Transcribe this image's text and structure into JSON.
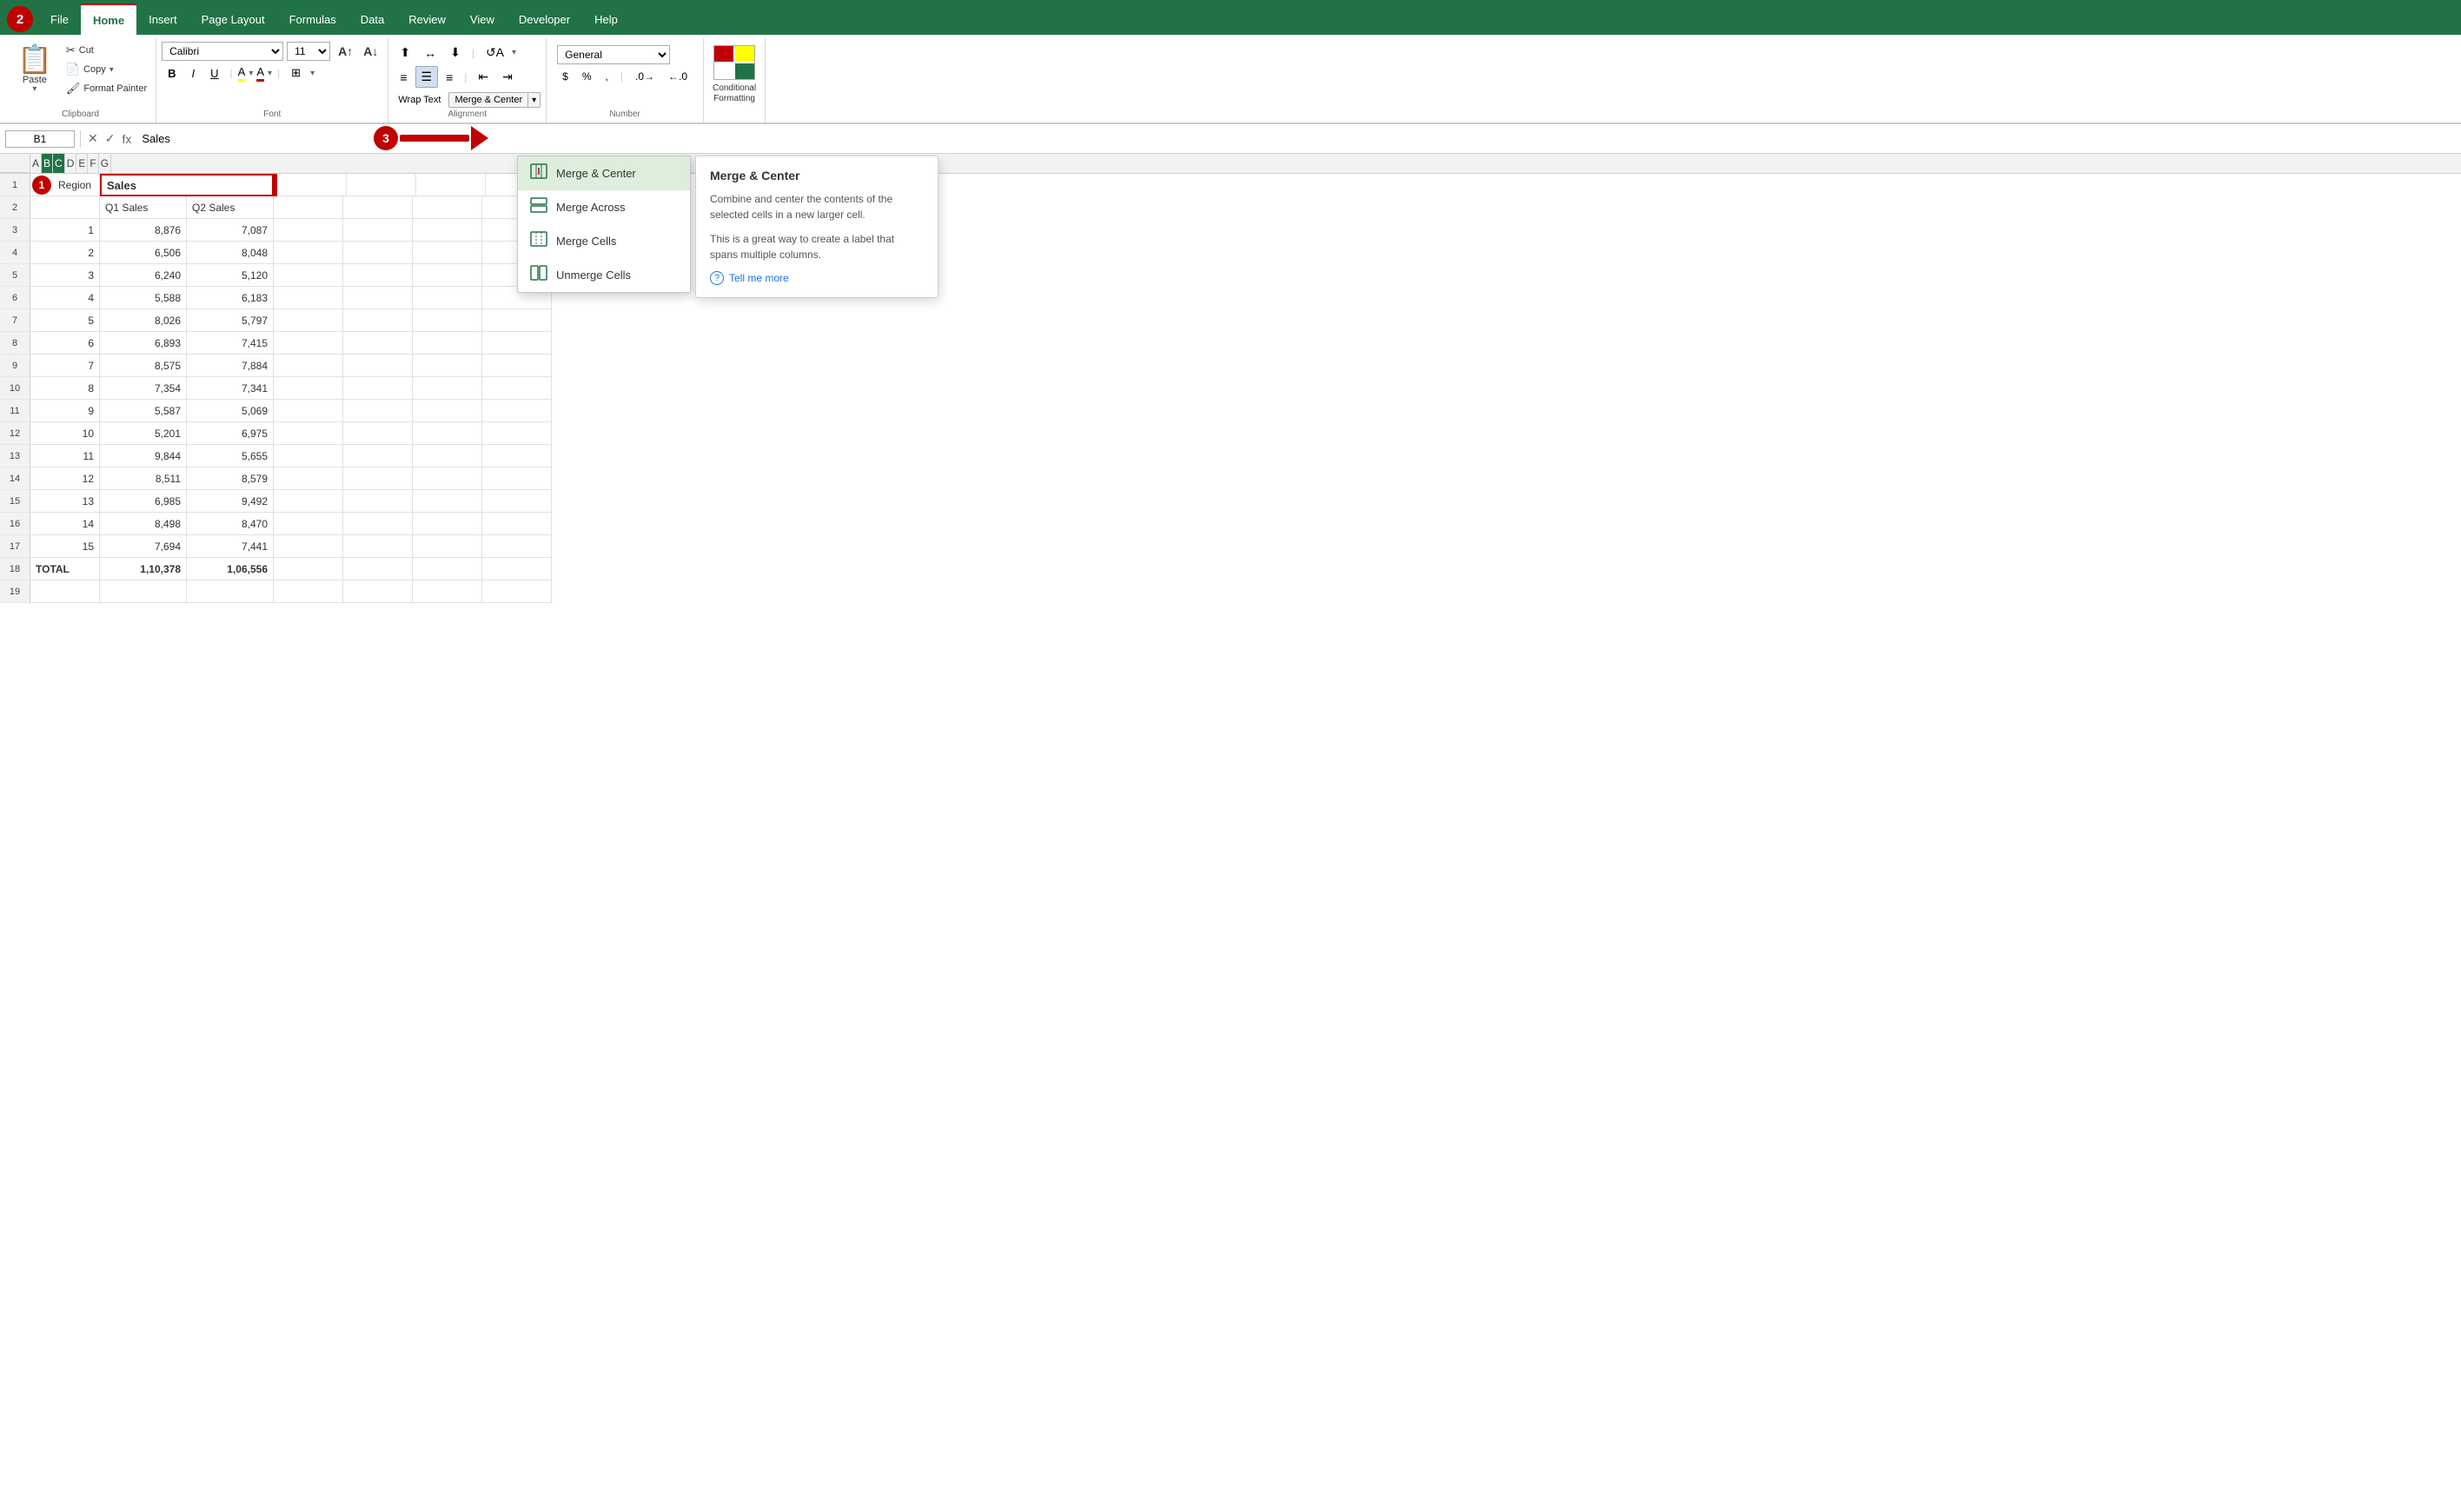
{
  "tabs": {
    "active": "Home",
    "items": [
      "File",
      "Home",
      "Insert",
      "Page Layout",
      "Formulas",
      "Data",
      "Review",
      "View",
      "Developer",
      "Help"
    ]
  },
  "clipboard": {
    "paste": "Paste",
    "cut": "Cut",
    "copy": "Copy",
    "format_painter": "Format Painter",
    "group_label": "Clipboard"
  },
  "font": {
    "family": "Calibri",
    "size": "11",
    "bold": "B",
    "italic": "I",
    "underline": "U",
    "group_label": "Font"
  },
  "alignment": {
    "wrap_text": "Wrap Text",
    "merge_center": "Merge & Center",
    "group_label": "Alignment"
  },
  "number": {
    "format": "General",
    "group_label": "Number"
  },
  "formula_bar": {
    "cell_ref": "B1",
    "value": "Sales"
  },
  "steps": {
    "step1": "1",
    "step2": "2",
    "step3": "3"
  },
  "merge_menu": {
    "title": "Merge & Center",
    "items": [
      {
        "id": "merge-center",
        "label": "Merge & Center",
        "icon": "⊞"
      },
      {
        "id": "merge-across",
        "label": "Merge Across",
        "icon": "⊟"
      },
      {
        "id": "merge-cells",
        "label": "Merge Cells",
        "icon": "⊠"
      },
      {
        "id": "unmerge-cells",
        "label": "Unmerge Cells",
        "icon": "⊡"
      }
    ]
  },
  "tooltip": {
    "title": "Merge & Center",
    "desc1": "Combine and center the contents of the selected cells in a new larger cell.",
    "desc2": "This is a great way to create a label that spans multiple columns.",
    "link": "Tell me more"
  },
  "columns": [
    "A",
    "B",
    "C",
    "D",
    "E",
    "F",
    "G"
  ],
  "rows": [
    {
      "num": "1",
      "a": "Region",
      "b": "Sales",
      "c": "",
      "d": "",
      "e": "",
      "f": "",
      "g": ""
    },
    {
      "num": "2",
      "a": "",
      "b": "Q1 Sales",
      "c": "Q2 Sales",
      "d": "",
      "e": "",
      "f": "",
      "g": ""
    },
    {
      "num": "3",
      "a": "1",
      "b": "8,876",
      "c": "7,087",
      "d": "",
      "e": "",
      "f": "",
      "g": ""
    },
    {
      "num": "4",
      "a": "2",
      "b": "6,506",
      "c": "8,048",
      "d": "",
      "e": "",
      "f": "",
      "g": ""
    },
    {
      "num": "5",
      "a": "3",
      "b": "6,240",
      "c": "5,120",
      "d": "",
      "e": "",
      "f": "",
      "g": ""
    },
    {
      "num": "6",
      "a": "4",
      "b": "5,588",
      "c": "6,183",
      "d": "",
      "e": "",
      "f": "",
      "g": ""
    },
    {
      "num": "7",
      "a": "5",
      "b": "8,026",
      "c": "5,797",
      "d": "",
      "e": "",
      "f": "",
      "g": ""
    },
    {
      "num": "8",
      "a": "6",
      "b": "6,893",
      "c": "7,415",
      "d": "",
      "e": "",
      "f": "",
      "g": ""
    },
    {
      "num": "9",
      "a": "7",
      "b": "8,575",
      "c": "7,884",
      "d": "",
      "e": "",
      "f": "",
      "g": ""
    },
    {
      "num": "10",
      "a": "8",
      "b": "7,354",
      "c": "7,341",
      "d": "",
      "e": "",
      "f": "",
      "g": ""
    },
    {
      "num": "11",
      "a": "9",
      "b": "5,587",
      "c": "5,069",
      "d": "",
      "e": "",
      "f": "",
      "g": ""
    },
    {
      "num": "12",
      "a": "10",
      "b": "5,201",
      "c": "6,975",
      "d": "",
      "e": "",
      "f": "",
      "g": ""
    },
    {
      "num": "13",
      "a": "11",
      "b": "9,844",
      "c": "5,655",
      "d": "",
      "e": "",
      "f": "",
      "g": ""
    },
    {
      "num": "14",
      "a": "12",
      "b": "8,511",
      "c": "8,579",
      "d": "",
      "e": "",
      "f": "",
      "g": ""
    },
    {
      "num": "15",
      "a": "13",
      "b": "6,985",
      "c": "9,492",
      "d": "",
      "e": "",
      "f": "",
      "g": ""
    },
    {
      "num": "16",
      "a": "14",
      "b": "8,498",
      "c": "8,470",
      "d": "",
      "e": "",
      "f": "",
      "g": ""
    },
    {
      "num": "17",
      "a": "15",
      "b": "7,694",
      "c": "7,441",
      "d": "",
      "e": "",
      "f": "",
      "g": ""
    },
    {
      "num": "18",
      "a": "TOTAL",
      "b": "1,10,378",
      "c": "1,06,556",
      "d": "",
      "e": "",
      "f": "",
      "g": ""
    },
    {
      "num": "19",
      "a": "",
      "b": "",
      "c": "",
      "d": "",
      "e": "",
      "f": "",
      "g": ""
    }
  ]
}
